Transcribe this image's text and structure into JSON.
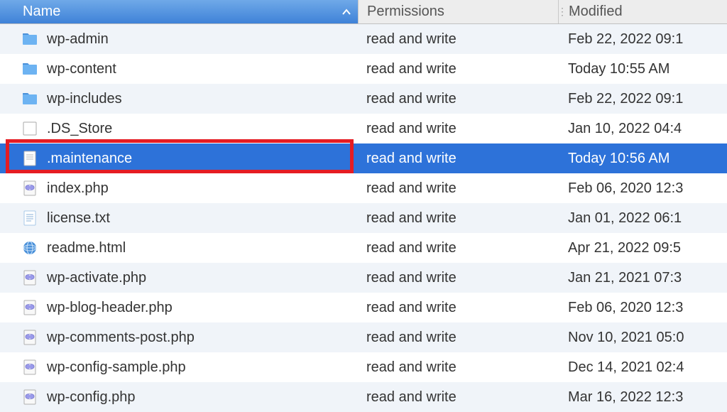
{
  "columns": {
    "name": "Name",
    "permissions": "Permissions",
    "modified": "Modified"
  },
  "rows": [
    {
      "icon": "folder",
      "name": "wp-admin",
      "permissions": "read and write",
      "modified": "Feb 22, 2022 09:1",
      "selected": false,
      "alt": true,
      "highlighted": false
    },
    {
      "icon": "folder",
      "name": "wp-content",
      "permissions": "read and write",
      "modified": "Today 10:55 AM",
      "selected": false,
      "alt": false,
      "highlighted": false
    },
    {
      "icon": "folder",
      "name": "wp-includes",
      "permissions": "read and write",
      "modified": "Feb 22, 2022 09:1",
      "selected": false,
      "alt": true,
      "highlighted": false
    },
    {
      "icon": "file-blank",
      "name": ".DS_Store",
      "permissions": "read and write",
      "modified": "Jan 10, 2022 04:4",
      "selected": false,
      "alt": false,
      "highlighted": false
    },
    {
      "icon": "file-doc",
      "name": ".maintenance",
      "permissions": "read and write",
      "modified": "Today 10:56 AM",
      "selected": true,
      "alt": true,
      "highlighted": true
    },
    {
      "icon": "file-php",
      "name": "index.php",
      "permissions": "read and write",
      "modified": "Feb 06, 2020 12:3",
      "selected": false,
      "alt": false,
      "highlighted": false
    },
    {
      "icon": "file-txt",
      "name": "license.txt",
      "permissions": "read and write",
      "modified": "Jan 01, 2022 06:1",
      "selected": false,
      "alt": true,
      "highlighted": false
    },
    {
      "icon": "file-html",
      "name": "readme.html",
      "permissions": "read and write",
      "modified": "Apr 21, 2022 09:5",
      "selected": false,
      "alt": false,
      "highlighted": false
    },
    {
      "icon": "file-php",
      "name": "wp-activate.php",
      "permissions": "read and write",
      "modified": "Jan 21, 2021 07:3",
      "selected": false,
      "alt": true,
      "highlighted": false
    },
    {
      "icon": "file-php",
      "name": "wp-blog-header.php",
      "permissions": "read and write",
      "modified": "Feb 06, 2020 12:3",
      "selected": false,
      "alt": false,
      "highlighted": false
    },
    {
      "icon": "file-php",
      "name": "wp-comments-post.php",
      "permissions": "read and write",
      "modified": "Nov 10, 2021 05:0",
      "selected": false,
      "alt": true,
      "highlighted": false
    },
    {
      "icon": "file-php",
      "name": "wp-config-sample.php",
      "permissions": "read and write",
      "modified": "Dec 14, 2021 02:4",
      "selected": false,
      "alt": false,
      "highlighted": false
    },
    {
      "icon": "file-php",
      "name": "wp-config.php",
      "permissions": "read and write",
      "modified": "Mar 16, 2022 12:3",
      "selected": false,
      "alt": true,
      "highlighted": false
    }
  ]
}
